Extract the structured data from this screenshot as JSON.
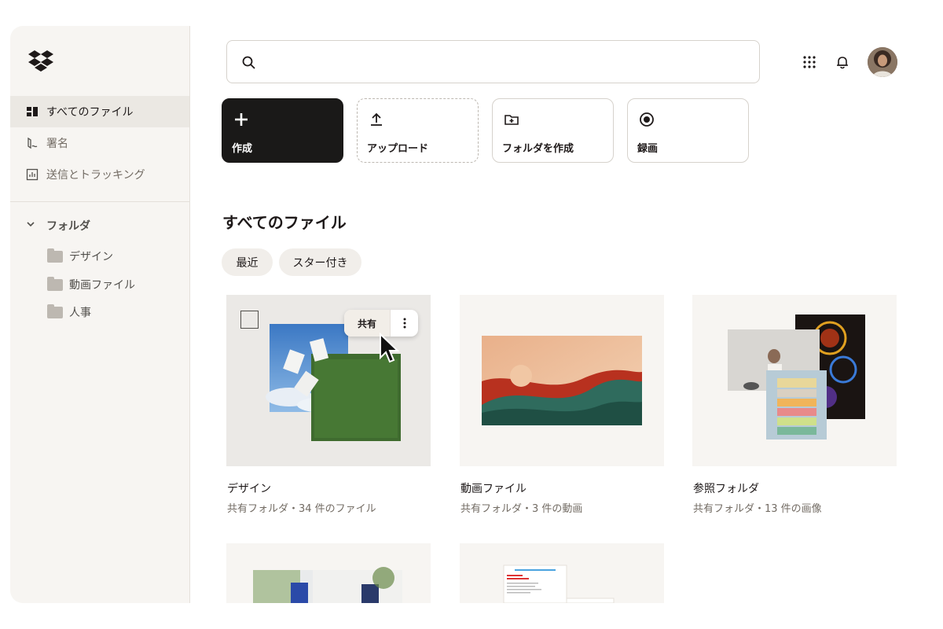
{
  "sidebar": {
    "nav": [
      {
        "label": "すべてのファイル",
        "icon": "files-icon"
      },
      {
        "label": "署名",
        "icon": "signature-icon"
      },
      {
        "label": "送信とトラッキング",
        "icon": "tracking-chart-icon"
      }
    ],
    "folders_heading": "フォルダ",
    "folders": [
      {
        "label": "デザイン"
      },
      {
        "label": "動画ファイル"
      },
      {
        "label": "人事"
      }
    ]
  },
  "search": {
    "placeholder": "",
    "value": ""
  },
  "actions": [
    {
      "label": "作成",
      "icon": "plus-icon"
    },
    {
      "label": "アップロード",
      "icon": "upload-icon"
    },
    {
      "label": "フォルダを作成",
      "icon": "folder-plus-icon"
    },
    {
      "label": "録画",
      "icon": "record-icon"
    }
  ],
  "main": {
    "title": "すべてのファイル",
    "filters": [
      {
        "label": "最近"
      },
      {
        "label": "スター付き"
      }
    ]
  },
  "cards": [
    {
      "name": "デザイン",
      "meta": "共有フォルダ・34 件のファイル"
    },
    {
      "name": "動画ファイル",
      "meta": "共有フォルダ・3 件の動画"
    },
    {
      "name": "参照フォルダ",
      "meta": "共有フォルダ・13 件の画像"
    }
  ],
  "hover_menu": {
    "share_label": "共有"
  },
  "colors": {
    "accent_dark": "#1a1918",
    "sidebar_bg": "#f7f5f2",
    "active_bg": "#ebe8e3"
  }
}
